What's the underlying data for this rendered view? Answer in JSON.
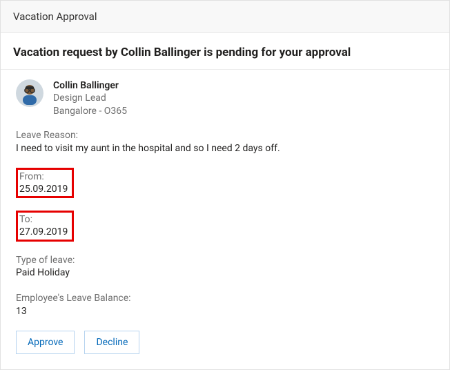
{
  "header": {
    "title": "Vacation Approval"
  },
  "subject": "Vacation request by Collin Ballinger is pending for your approval",
  "requester": {
    "name": "Collin Ballinger",
    "role": "Design Lead",
    "location": "Bangalore - O365"
  },
  "fields": {
    "reason_label": "Leave Reason:",
    "reason_value": "I need to visit my aunt in the hospital and so I need 2 days off.",
    "from_label": "From:",
    "from_value": "25.09.2019",
    "to_label": "To:",
    "to_value": "27.09.2019",
    "type_label": "Type of leave:",
    "type_value": "Paid Holiday",
    "balance_label": "Employee's Leave Balance:",
    "balance_value": "13"
  },
  "actions": {
    "approve": "Approve",
    "decline": "Decline"
  }
}
